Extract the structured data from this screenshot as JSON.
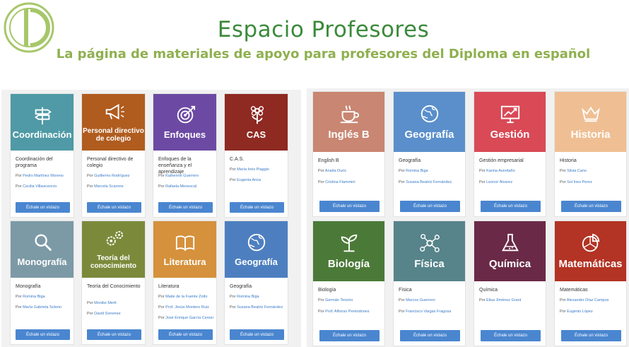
{
  "header": {
    "title": "Espacio Profesores",
    "subtitle": "La página de materiales de apoyo para profesores del Diploma en español"
  },
  "colors": {
    "title": "#3b8a3b",
    "subtitle": "#8fb04f",
    "logo": "#a6c76a",
    "button": "#4a86d0",
    "link": "#3a7bc8"
  },
  "author_prefix": "Por",
  "button_label": "Échale un vistazo",
  "left_cards": [
    {
      "image_label": "Coordinación",
      "icon": "signpost-icon",
      "color": "#4f9aa6",
      "title": "Coordinación del programa",
      "authors": [
        "Pedro Martínez Moreno",
        "Cecilia Villavicencio"
      ]
    },
    {
      "image_label": "Personal directivo de colegio",
      "icon": "megaphone-icon",
      "color": "#b05c1f",
      "title": "Personal directivo de colegio",
      "authors": [
        "Guillermo Rodríguez",
        "Marcela Scarone"
      ]
    },
    {
      "image_label": "Enfoques",
      "icon": "target-icon",
      "color": "#6c4aa3",
      "title": "Enfoques de la enseñanza y el aprendizaje",
      "authors": [
        "Katherine Guerrero",
        "Rafaela Menescal"
      ]
    },
    {
      "image_label": "CAS",
      "icon": "flower-icon",
      "color": "#8e2a22",
      "title": "C.A.S.",
      "authors": [
        "María Inés Piaggio",
        "Eugenia Ariza"
      ]
    },
    {
      "image_label": "Monografía",
      "icon": "magnifier-icon",
      "color": "#7c9aa6",
      "title": "Monografía",
      "authors": [
        "Romina Biga",
        "María Gabriela Solorio"
      ]
    },
    {
      "image_label": "Teoría del conocimiento",
      "icon": "gears-icon",
      "color": "#7b8a3a",
      "title": "Teoría del Conocimiento",
      "authors": [
        "Monike Mertl",
        "David Sonenee"
      ]
    },
    {
      "image_label": "Literatura",
      "icon": "book-icon",
      "color": "#d5913c",
      "title": "Literatura",
      "authors": [
        "Maite de la Fuente Zotlo",
        "Prof. Jesús Montero Ruiz",
        "José Enrique García Cerezán"
      ]
    },
    {
      "image_label": "Geografía",
      "icon": "globe-icon",
      "color": "#4d7fc0",
      "title": "Geografía",
      "authors": [
        "Romina Biga",
        "Susana Beatriz Fernández"
      ]
    }
  ],
  "right_cards": [
    {
      "image_label": "Inglés B",
      "icon": "tea-cup-icon",
      "color": "#c98672",
      "title": "English B",
      "authors": [
        "Analía Ouris",
        "Cristina Flammini"
      ]
    },
    {
      "image_label": "Geografía",
      "icon": "globe-icon",
      "color": "#5a8fcb",
      "title": "Geografía",
      "authors": [
        "Romina Biga",
        "Susana Beatriz Fernández"
      ]
    },
    {
      "image_label": "Gestión",
      "icon": "chart-board-icon",
      "color": "#d94956",
      "title": "Gestión empresarial",
      "authors": [
        "Karina Averdaño",
        "Leonor Álvarez"
      ]
    },
    {
      "image_label": "Historia",
      "icon": "crown-icon",
      "color": "#efbf93",
      "title": "Historia",
      "authors": [
        "Silvia Cano",
        "Sol Ines Perez"
      ]
    },
    {
      "image_label": "Biología",
      "icon": "sprout-icon",
      "color": "#4b7a38",
      "title": "Biología",
      "authors": [
        "Germán Tenorio",
        "Prof. Alfonso Perendones"
      ]
    },
    {
      "image_label": "Física",
      "icon": "molecule-icon",
      "color": "#56848a",
      "title": "Física",
      "authors": [
        "Marcos Guerrero",
        "Francisco Vargas Fragosa"
      ]
    },
    {
      "image_label": "Química",
      "icon": "flask-icon",
      "color": "#6a2a47",
      "title": "Química",
      "authors": [
        "Elisa Jiménez Grant"
      ]
    },
    {
      "image_label": "Matemáticas",
      "icon": "pie-chart-icon",
      "color": "#b33324",
      "title": "Matemáticas",
      "authors": [
        "Alexander Díaz Campos",
        "Eugenio López"
      ]
    }
  ]
}
